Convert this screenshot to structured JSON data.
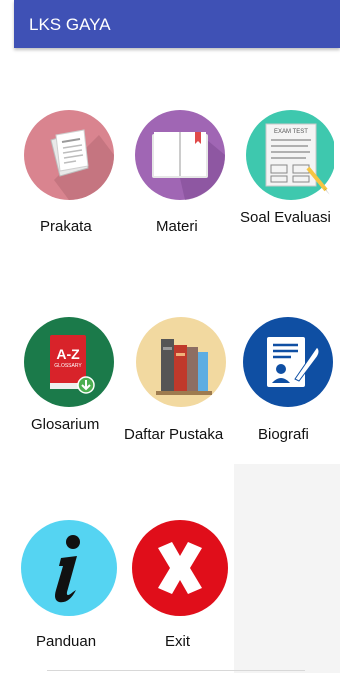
{
  "app": {
    "title": "LKS GAYA"
  },
  "menu": {
    "prakata": "Prakata",
    "materi": "Materi",
    "soal_evaluasi": "Soal Evaluasi",
    "glosarium": "Glosarium",
    "daftar_pustaka": "Daftar Pustaka",
    "biografi": "Biografi",
    "panduan": "Panduan",
    "exit": "Exit"
  },
  "icon_text": {
    "exam_sheet": "EXAM TEST",
    "glossary_az": "A-Z",
    "glossary_word": "GLOSSARY"
  },
  "colors": {
    "appbar": "#3f51b5",
    "prakata_bg": "#d9848f",
    "materi_bg": "#a066b4",
    "soal_bg": "#3ec8ae",
    "glosarium_bg": "#1b7a4a",
    "daftar_bg": "#f2d9a0",
    "biografi_bg": "#0f4fa3",
    "panduan_bg": "#55d4f2",
    "exit_bg": "#e00e1a"
  }
}
